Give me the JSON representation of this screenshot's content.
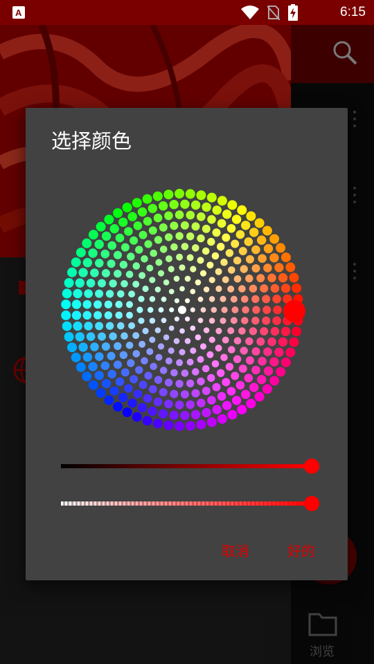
{
  "status_bar": {
    "time": "6:15",
    "icons": [
      "notification-a-icon",
      "wifi-icon",
      "no-sim-icon",
      "battery-charging-icon"
    ]
  },
  "background": {
    "browse_label": "浏览",
    "icons": [
      "search-icon",
      "globe-icon",
      "folder-icon",
      "overflow-menu-icon"
    ]
  },
  "dialog": {
    "title": "选择颜色",
    "selected_color": "#ff0000",
    "value_level": 1.0,
    "alpha_level": 1.0,
    "cancel_label": "取消",
    "ok_label": "好的"
  },
  "colors": {
    "accent": "#e00000",
    "status_bar": "#7a0000",
    "dialog_bg": "#424242"
  }
}
